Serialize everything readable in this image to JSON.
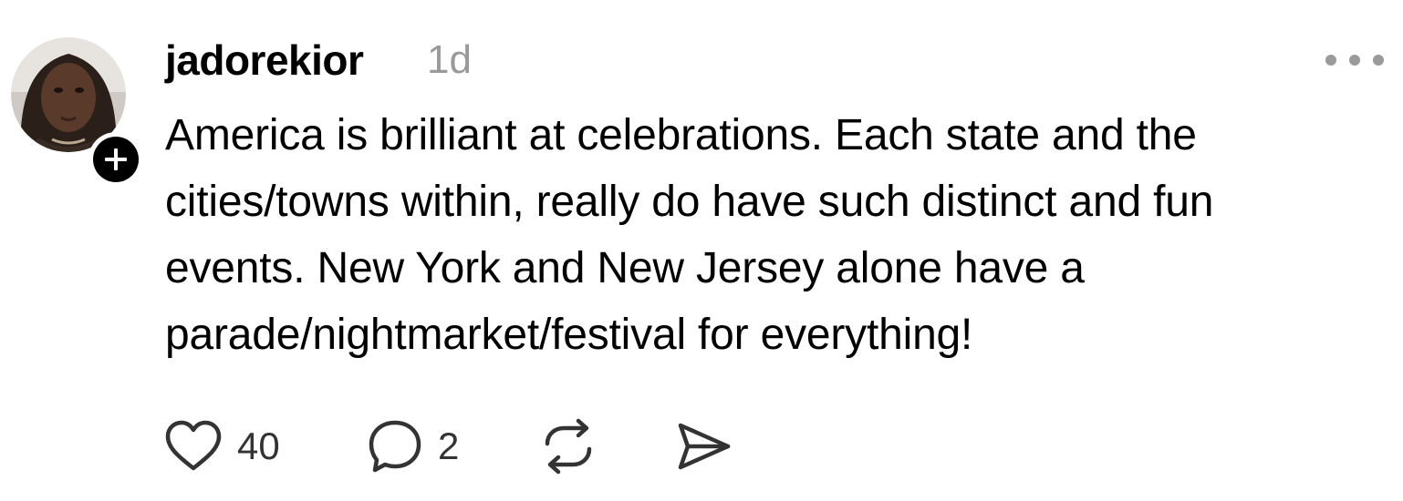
{
  "post": {
    "username": "jadorekior",
    "timestamp": "1d",
    "text_lines": [
      "America is brilliant at celebrations. Each state and the",
      "cities/towns within, really do have such distinct and fun",
      "events. New York and New Jersey alone have a",
      "parade/nightmarket/festival for everything!"
    ],
    "likes": "40",
    "replies": "2"
  },
  "icons": {
    "follow": "plus-circle-icon",
    "more": "more-dots-icon",
    "like": "heart-icon",
    "reply": "speech-bubble-icon",
    "repost": "repost-icon",
    "share": "send-icon"
  },
  "colors": {
    "text": "#000000",
    "muted": "#9a9a9a",
    "icon": "#333333"
  }
}
